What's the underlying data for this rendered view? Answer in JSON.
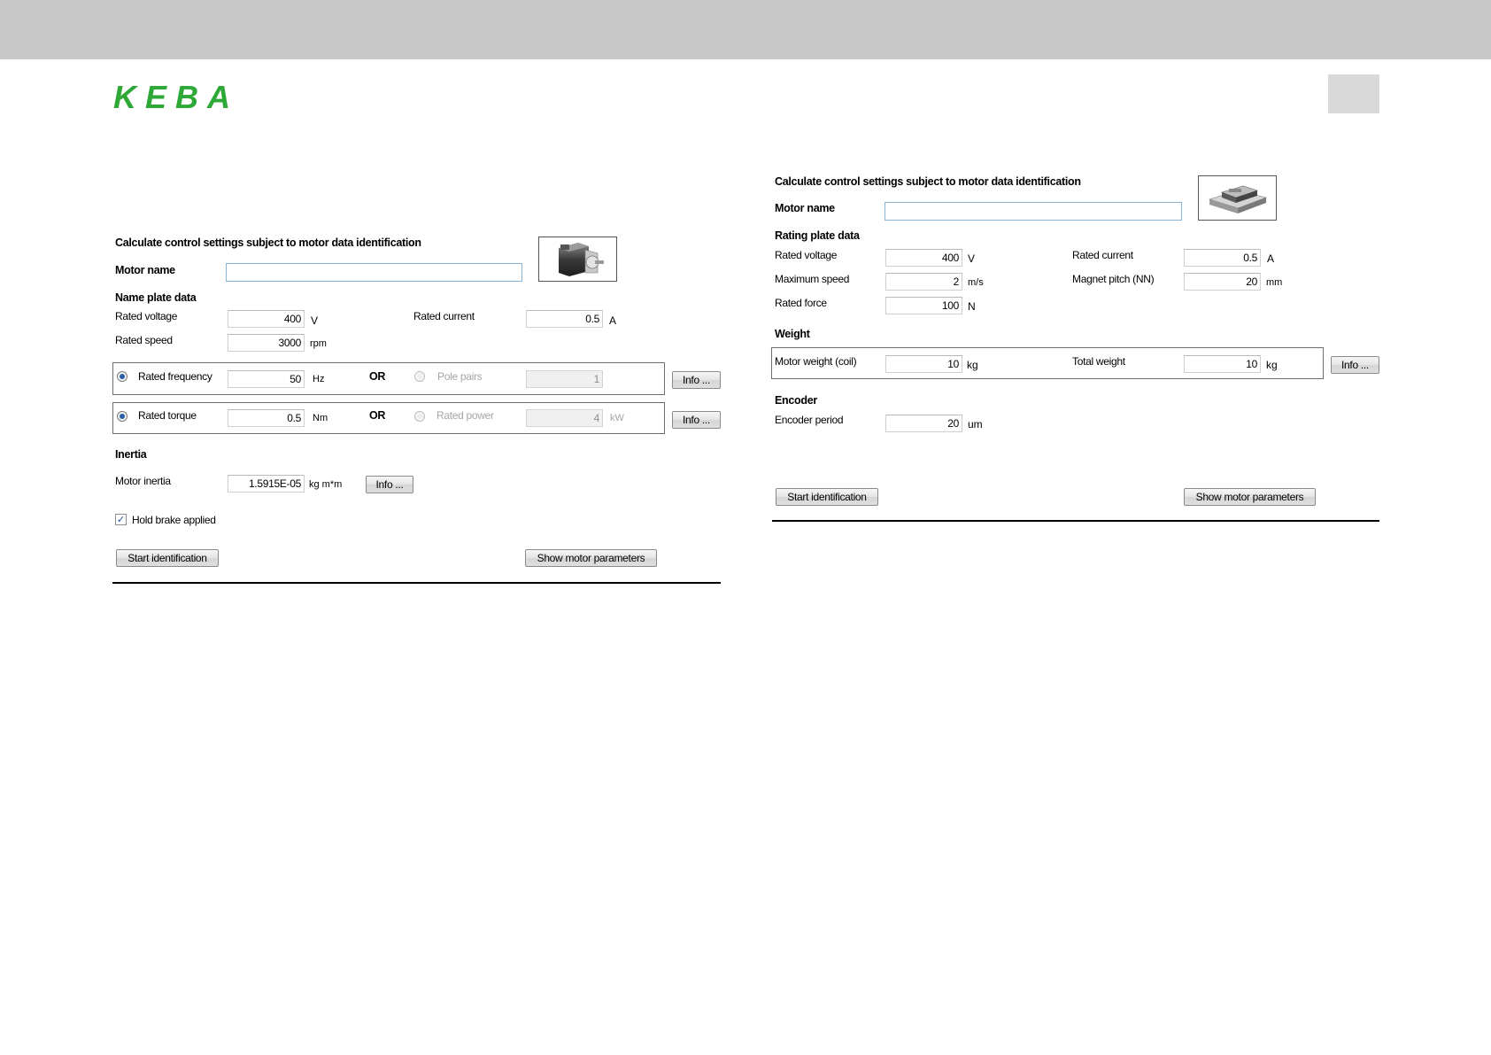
{
  "brand": {
    "logo_text": "KEBA",
    "logo_color": "#2ea836"
  },
  "left_panel": {
    "heading": "Calculate control settings subject to motor data identification",
    "motor_name_label": "Motor name",
    "motor_name_value": "",
    "motor_image_icon": "rotary-motor-icon",
    "section_nameplate": "Name plate data",
    "rated_voltage": {
      "label": "Rated voltage",
      "value": "400",
      "unit": "V"
    },
    "rated_current": {
      "label": "Rated current",
      "value": "0.5",
      "unit": "A"
    },
    "rated_speed": {
      "label": "Rated speed",
      "value": "3000",
      "unit": "rpm"
    },
    "group_freq": {
      "option_a": {
        "label": "Rated frequency",
        "value": "50",
        "unit": "Hz",
        "selected": true
      },
      "or_label": "OR",
      "option_b": {
        "label": "Pole pairs",
        "value": "1",
        "unit": "",
        "selected": false
      },
      "info_button": "Info ..."
    },
    "group_torque": {
      "option_a": {
        "label": "Rated torque",
        "value": "0.5",
        "unit": "Nm",
        "selected": true
      },
      "or_label": "OR",
      "option_b": {
        "label": "Rated power",
        "value": "4",
        "unit": "kW",
        "selected": false
      },
      "info_button": "Info ..."
    },
    "section_inertia": "Inertia",
    "motor_inertia": {
      "label": "Motor inertia",
      "value": "1.5915E-05",
      "unit": "kg m*m",
      "info_button": "Info ..."
    },
    "hold_brake": {
      "label": "Hold brake applied",
      "checked": true,
      "check_glyph": "✓"
    },
    "start_button": "Start identification",
    "show_button": "Show motor parameters"
  },
  "right_panel": {
    "heading": "Calculate control settings subject to motor data identification",
    "motor_name_label": "Motor name",
    "motor_name_value": "",
    "motor_image_icon": "linear-motor-icon",
    "section_rating": "Rating plate data",
    "rated_voltage": {
      "label": "Rated voltage",
      "value": "400",
      "unit": "V"
    },
    "rated_current": {
      "label": "Rated current",
      "value": "0.5",
      "unit": "A"
    },
    "maximum_speed": {
      "label": "Maximum speed",
      "value": "2",
      "unit": "m/s"
    },
    "magnet_pitch": {
      "label": "Magnet pitch (NN)",
      "value": "20",
      "unit": "mm"
    },
    "rated_force": {
      "label": "Rated force",
      "value": "100",
      "unit": "N"
    },
    "section_weight": "Weight",
    "motor_weight": {
      "label": "Motor weight (coil)",
      "value": "10",
      "unit": "kg"
    },
    "total_weight": {
      "label": "Total weight",
      "value": "10",
      "unit": "kg"
    },
    "weight_info_button": "Info ...",
    "section_encoder": "Encoder",
    "encoder_period": {
      "label": "Encoder period",
      "value": "20",
      "unit": "um"
    },
    "start_button": "Start identification",
    "show_button": "Show motor parameters"
  }
}
